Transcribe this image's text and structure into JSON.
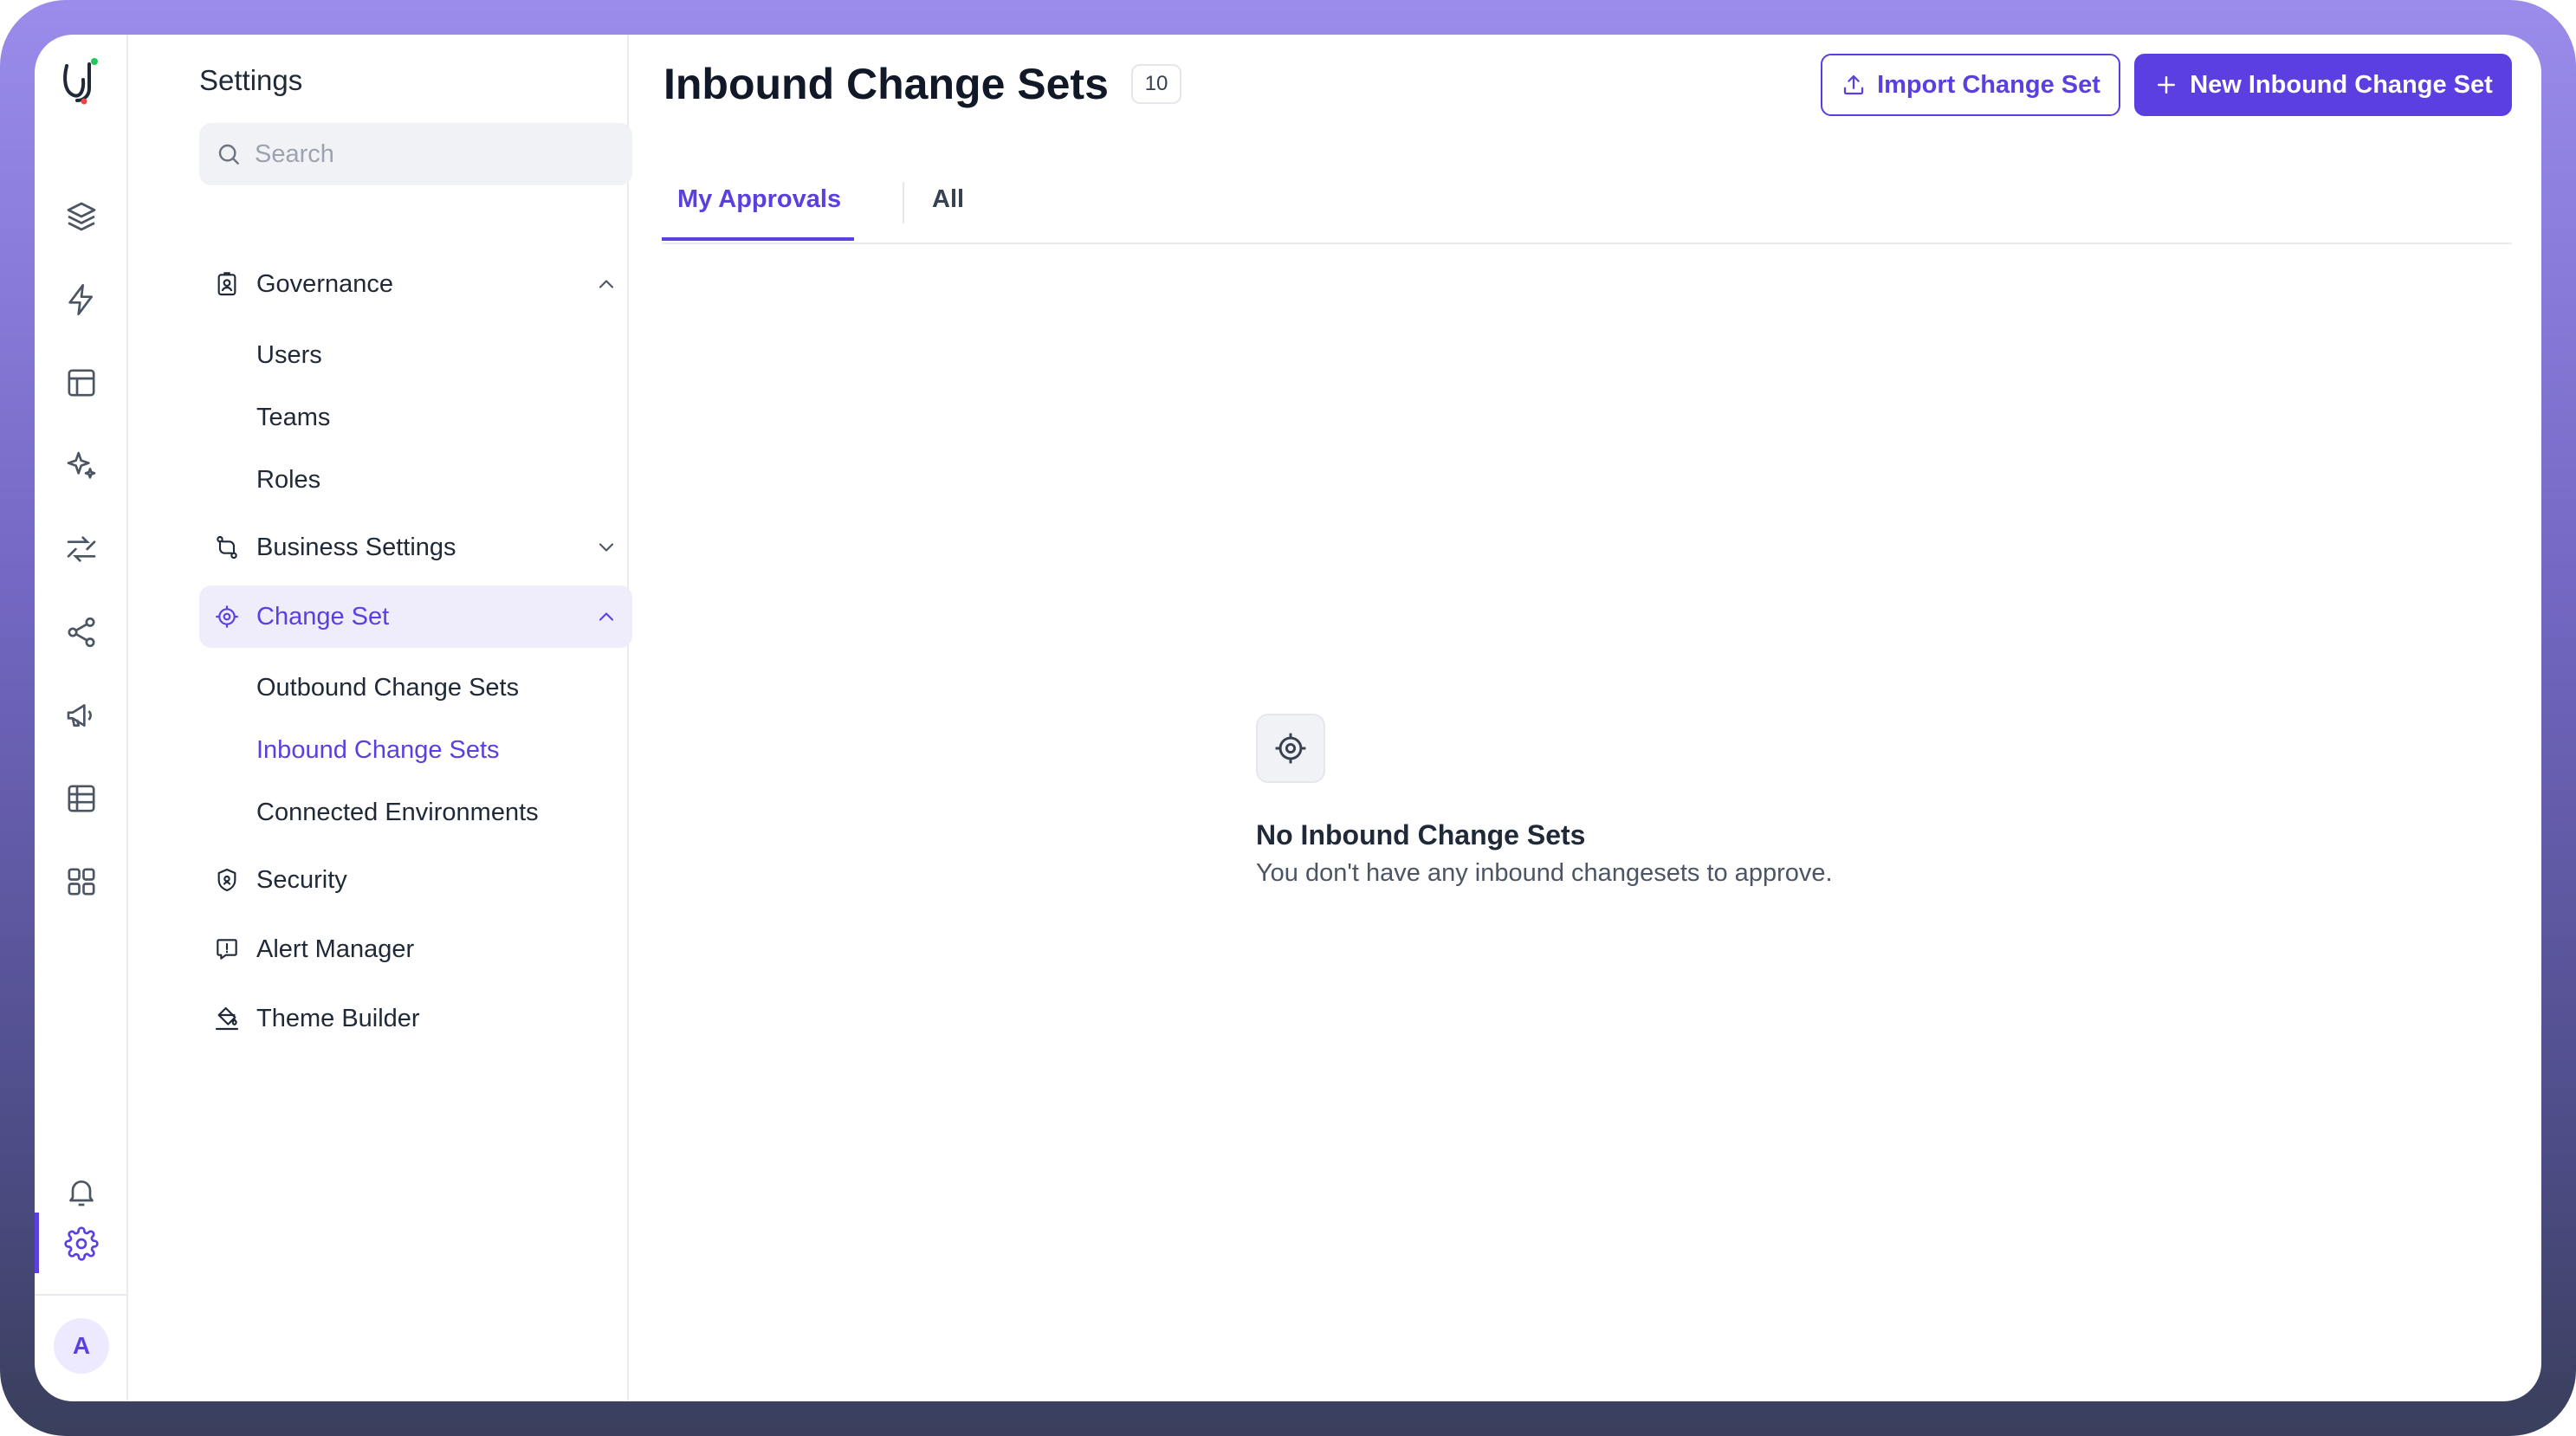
{
  "sidebar": {
    "title": "Settings",
    "search_placeholder": "Search",
    "groups": [
      {
        "label": "Governance",
        "icon": "badge-icon",
        "expanded": true,
        "items": [
          {
            "label": "Users"
          },
          {
            "label": "Teams"
          },
          {
            "label": "Roles"
          }
        ]
      },
      {
        "label": "Business Settings",
        "icon": "route-icon",
        "expanded": false,
        "items": []
      },
      {
        "label": "Change Set",
        "icon": "target-icon",
        "expanded": true,
        "active": true,
        "items": [
          {
            "label": "Outbound Change Sets"
          },
          {
            "label": "Inbound Change Sets",
            "active": true
          },
          {
            "label": "Connected Environments"
          }
        ]
      },
      {
        "label": "Security",
        "icon": "shield-icon"
      },
      {
        "label": "Alert Manager",
        "icon": "alert-message-icon"
      },
      {
        "label": "Theme Builder",
        "icon": "paint-bucket-icon"
      }
    ]
  },
  "rail": {
    "icons": [
      "app-logo-icon",
      "layers-icon",
      "bolt-icon",
      "layout-icon",
      "sparkles-icon",
      "shuffle-icon",
      "share-icon",
      "megaphone-icon",
      "table-icon",
      "grid-icon",
      "bell-icon",
      "gear-icon"
    ],
    "active": "gear-icon",
    "avatar_initial": "A"
  },
  "header": {
    "title": "Inbound Change Sets",
    "count": "10",
    "import_label": "Import Change Set",
    "new_label": "New Inbound Change Set"
  },
  "tabs": [
    {
      "label": "My Approvals",
      "active": true
    },
    {
      "label": "All",
      "active": false
    }
  ],
  "empty_state": {
    "icon": "target-icon",
    "title": "No Inbound Change Sets",
    "message": "You don't have any inbound changesets to approve."
  },
  "colors": {
    "accent": "#5b3fe0",
    "accent_bg": "#efecfb",
    "frame_gradient_top": "#9b8cec",
    "frame_gradient_bottom": "#393f5c"
  }
}
